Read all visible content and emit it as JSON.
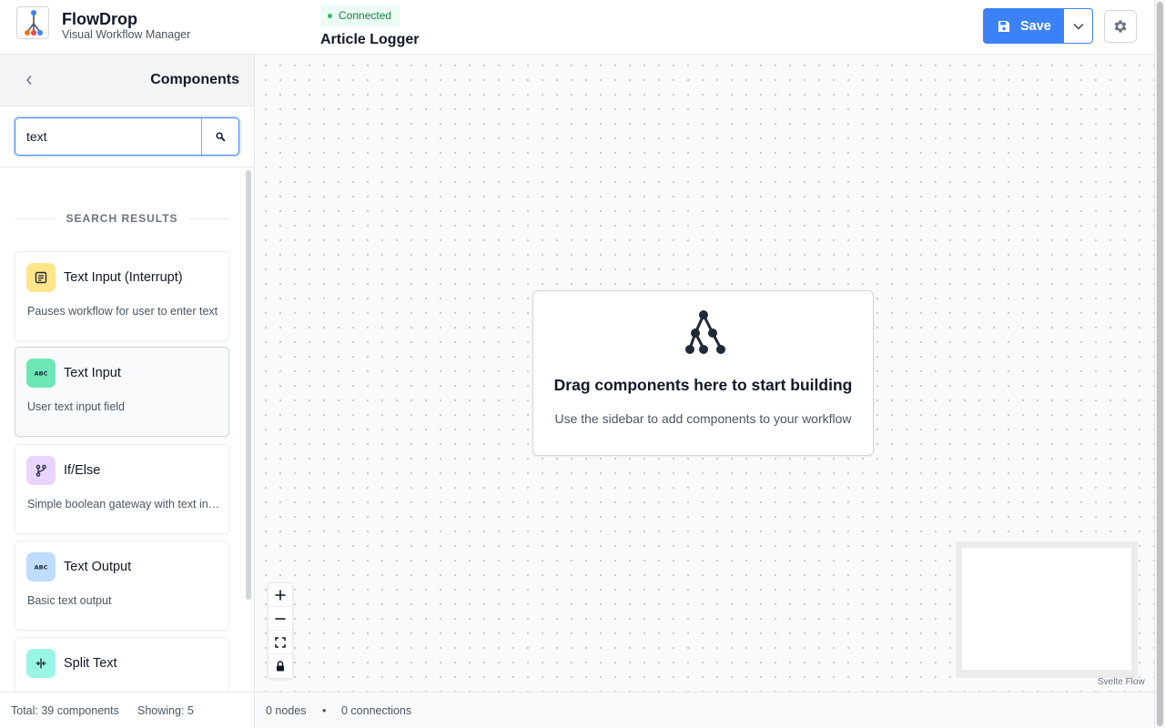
{
  "header": {
    "app_title": "FlowDrop",
    "app_subtitle": "Visual Workflow Manager",
    "status": "Connected",
    "workflow_title": "Article Logger",
    "save_label": "Save",
    "logo_icon": "workflow-tree-icon",
    "settings_icon": "gear-icon",
    "accent_color": "#3b82f6",
    "status_color": "#22c55e"
  },
  "sidebar": {
    "title": "Components",
    "search": {
      "value": "text",
      "placeholder": ""
    },
    "results_header": "SEARCH RESULTS",
    "items": [
      {
        "title": "Text Input (Interrupt)",
        "description": "Pauses workflow for user to enter text",
        "icon": "form-icon",
        "icon_bg": "#fde68a"
      },
      {
        "title": "Text Input",
        "description": "User text input field",
        "icon": "abc-icon",
        "icon_bg": "#6ee7b7"
      },
      {
        "title": "If/Else",
        "description": "Simple boolean gateway with text input",
        "icon": "branch-icon",
        "icon_bg": "#e9d5ff"
      },
      {
        "title": "Text Output",
        "description": "Basic text output",
        "icon": "abc-icon",
        "icon_bg": "#bfdbfe"
      },
      {
        "title": "Split Text",
        "description": "",
        "icon": "split-icon",
        "icon_bg": "#99f6e4"
      }
    ],
    "footer": {
      "total": "Total: 39 components",
      "showing": "Showing: 5"
    }
  },
  "canvas": {
    "empty_title": "Drag components here to start building",
    "empty_subtitle": "Use the sidebar to add components to your workflow",
    "attribution": "Svelte Flow",
    "footer": {
      "nodes": "0 nodes",
      "separator": "•",
      "connections": "0 connections"
    }
  }
}
